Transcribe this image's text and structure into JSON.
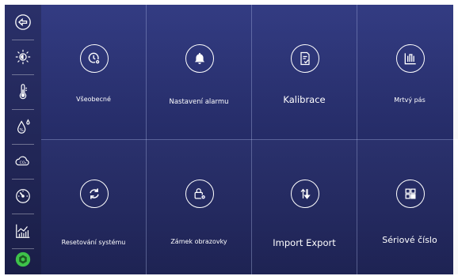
{
  "sidebar": {
    "items": [
      {
        "icon": "back-arrow-icon"
      },
      {
        "icon": "sun-brightness-icon"
      },
      {
        "icon": "thermometer-icon"
      },
      {
        "icon": "humidity-icon"
      },
      {
        "icon": "co2-cloud-icon"
      },
      {
        "icon": "gauge-icon"
      },
      {
        "icon": "chart-icon"
      },
      {
        "icon": "settings-hexagon-icon",
        "active_color": "#3ec24a"
      }
    ]
  },
  "tiles": [
    {
      "label": "Všeobecné",
      "icon": "clock-gear-icon"
    },
    {
      "label": "Nastavení alarmu",
      "icon": "alarm-bell-icon"
    },
    {
      "label": "Kalibrace",
      "icon": "calibration-doc-icon"
    },
    {
      "label": "Mrtvý pás",
      "icon": "dead-band-icon"
    },
    {
      "label": "Resetování systému",
      "icon": "reset-arrows-icon"
    },
    {
      "label": "Zámek obrazovky",
      "icon": "lock-gear-icon"
    },
    {
      "label": "Import Export",
      "icon": "import-export-icon"
    },
    {
      "label": "Sériové číslo",
      "icon": "serial-grid-icon"
    }
  ],
  "colors": {
    "background": "#2a3070",
    "sidebar": "#22275a",
    "accent": "#3ec24a",
    "text": "#ffffff"
  }
}
